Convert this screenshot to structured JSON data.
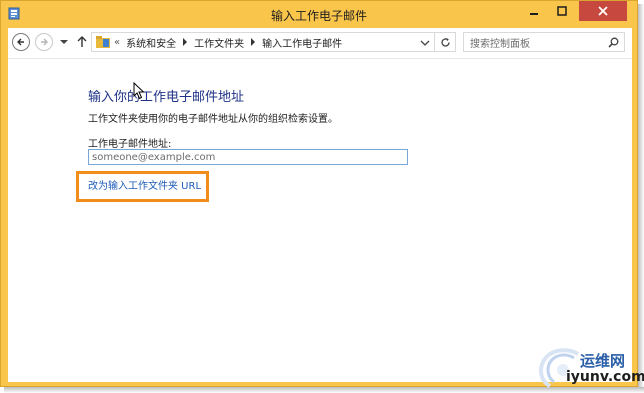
{
  "window": {
    "title": "输入工作电子邮件"
  },
  "navigation": {
    "breadcrumbs": [
      "系统和安全",
      "工作文件夹",
      "输入工作电子邮件"
    ],
    "overflow_label": "«",
    "search_placeholder": "搜索控制面板"
  },
  "content": {
    "heading": "输入你的工作电子邮件地址",
    "description": "工作文件夹使用你的电子邮件地址从你的组织检索设置。",
    "email_label": "工作电子邮件地址:",
    "email_placeholder": "someone@example.com",
    "url_link": "改为输入工作文件夹 URL"
  },
  "watermark": {
    "brand": "运维网",
    "url": "iyunv.com"
  },
  "colors": {
    "titlebar": "#f9c54a",
    "close_button": "#c7483e",
    "heading": "#1e3287",
    "link": "#1e5bb8",
    "highlight": "#f28d1b"
  }
}
